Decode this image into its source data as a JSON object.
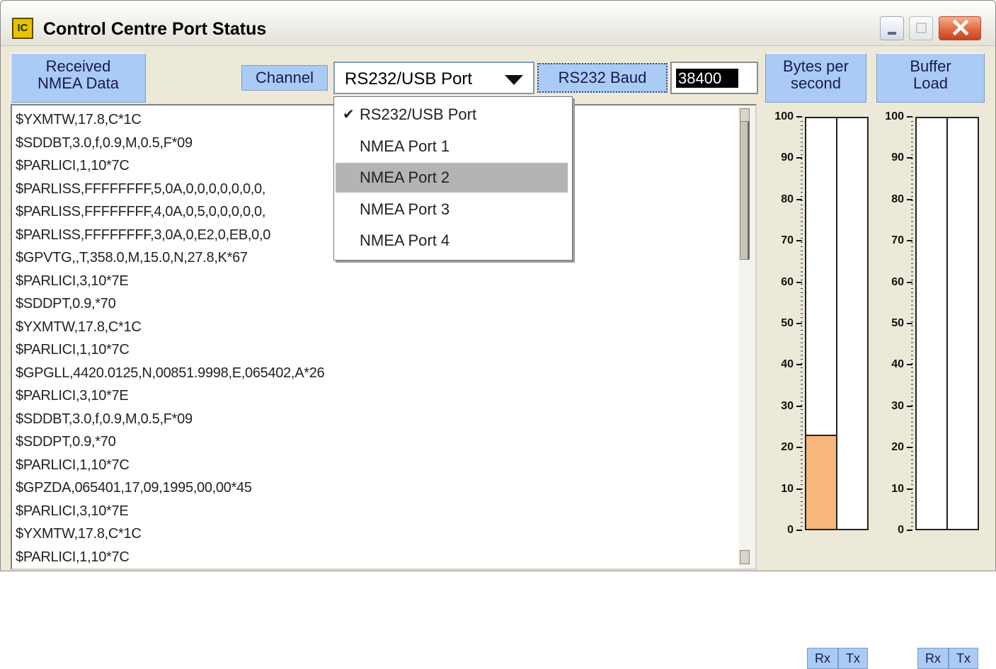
{
  "window": {
    "title": "Control Centre Port Status",
    "icon": "app-ic-icon",
    "icon_text": "IC"
  },
  "caption_buttons": {
    "minimize": "minimize-icon",
    "maximize": "maximize-icon",
    "close": "close-icon",
    "close_glyph": "✕"
  },
  "labels": {
    "received_line1": "Received",
    "received_line2": "NMEA Data",
    "channel": "Channel",
    "baud": "RS232 Baud",
    "bps_line1": "Bytes per",
    "bps_line2": "second",
    "buf_line1": "Buffer",
    "buf_line2": "Load"
  },
  "channel": {
    "selected": "RS232/USB Port",
    "options": [
      "RS232/USB Port",
      "NMEA Port 1",
      "NMEA Port 2",
      "NMEA Port 3",
      "NMEA Port 4"
    ],
    "checked_index": 0,
    "highlighted_index": 2,
    "check_glyph": "✔"
  },
  "baud": {
    "value": "38400"
  },
  "log_lines": [
    "$YXMTW,17.8,C*1C",
    "$SDDBT,3.0,f,0.9,M,0.5,F*09",
    "$PARLICI,1,10*7C",
    "$PARLISS,FFFFFFFF,5,0A,0,0,0,0,0,0,0,",
    "$PARLISS,FFFFFFFF,4,0A,0,5,0,0,0,0,0,",
    "$PARLISS,FFFFFFFF,3,0A,0,E2,0,EB,0,0",
    "$GPVTG,,T,358.0,M,15.0,N,27.8,K*67",
    "$PARLICI,3,10*7E",
    "$SDDPT,0.9,*70",
    "$YXMTW,17.8,C*1C",
    "$PARLICI,1,10*7C",
    "$GPGLL,4420.0125,N,00851.9998,E,065402,A*26",
    "$PARLICI,3,10*7E",
    "$SDDBT,3.0,f,0.9,M,0.5,F*09",
    "$SDDPT,0.9,*70",
    "$PARLICI,1,10*7C",
    "$GPZDA,065401,17,09,1995,00,00*45",
    "$PARLICI,3,10*7E",
    "$YXMTW,17.8,C*1C",
    "$PARLICI,1,10*7C"
  ],
  "gauges": {
    "ticks": [
      "100",
      "90",
      "80",
      "70",
      "60",
      "50",
      "40",
      "30",
      "20",
      "10",
      "0"
    ],
    "bytes_per_second": {
      "rx": 23,
      "tx": 0
    },
    "buffer_load": {
      "rx": 0,
      "tx": 0
    },
    "rx_label": "Rx",
    "tx_label": "Tx",
    "fill_color": "#f8b67a"
  }
}
